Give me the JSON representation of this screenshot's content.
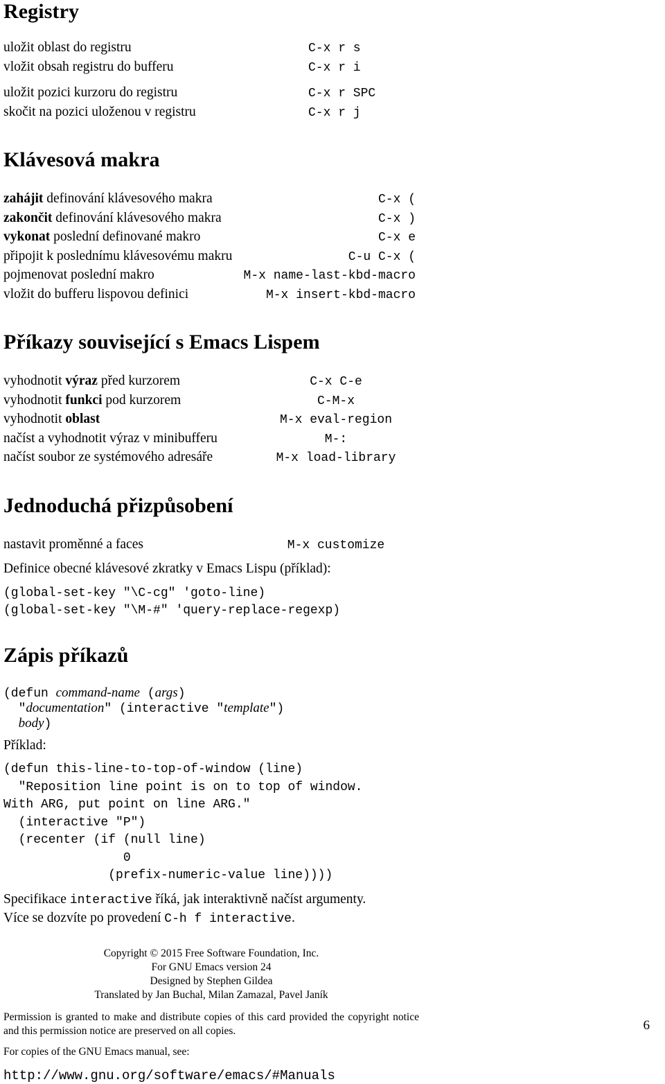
{
  "document": {
    "page_number": "6"
  },
  "sections": {
    "registry": {
      "heading": "Registry",
      "rows": [
        {
          "desc": "uložit oblast do registru",
          "key": "C-x r s"
        },
        {
          "desc": "vložit obsah registru do bufferu",
          "key": "C-x r i"
        },
        {
          "desc": "uložit pozici kurzoru do registru",
          "key": "C-x r SPC"
        },
        {
          "desc": "skočit na pozici uloženou v registru",
          "key": "C-x r j"
        }
      ]
    },
    "macros": {
      "heading": "Klávesová makra",
      "rows": [
        {
          "bold": "zahájit",
          "rest": " definování klávesového makra",
          "key": "C-x ("
        },
        {
          "bold": "zakončit",
          "rest": " definování klávesového makra",
          "key": "C-x )"
        },
        {
          "bold": "vykonat",
          "rest": " poslední definované makro",
          "key": "C-x e"
        },
        {
          "bold": "",
          "rest": "připojit k poslednímu klávesovému makru",
          "key": "C-u C-x ("
        },
        {
          "bold": "",
          "rest": "pojmenovat poslední makro",
          "key": "M-x name-last-kbd-macro"
        },
        {
          "bold": "",
          "rest": "vložit do bufferu lispovou definici",
          "key": "M-x insert-kbd-macro"
        }
      ]
    },
    "lisp": {
      "heading": "Příkazy související s Emacs Lispem",
      "rows": [
        {
          "pre": "vyhodnotit ",
          "bold": "výraz",
          "post": " před kurzorem",
          "key": "C-x C-e"
        },
        {
          "pre": "vyhodnotit ",
          "bold": "funkci",
          "post": " pod kurzorem",
          "key": "C-M-x"
        },
        {
          "pre": "vyhodnotit ",
          "bold": "oblast",
          "post": "",
          "key": "M-x eval-region"
        },
        {
          "pre": "načíst a vyhodnotit výraz v minibufferu",
          "bold": "",
          "post": "",
          "key": "M-:"
        },
        {
          "pre": "načíst soubor ze systémového adresáře",
          "bold": "",
          "post": "",
          "key": "M-x load-library"
        }
      ]
    },
    "customization": {
      "heading": "Jednoduchá přizpůsobení",
      "rows": [
        {
          "desc": "nastavit proměnné a faces",
          "key": "M-x customize"
        }
      ],
      "intro": "Definice obecné klávesové zkratky v Emacs Lispu (příklad):",
      "code_lines": [
        "(global-set-key \"\\C-cg\" 'goto-line)",
        "(global-set-key \"\\M-#\" 'query-replace-regexp)"
      ]
    },
    "writing_commands": {
      "heading": "Zápis příkazů",
      "template": {
        "line1_a": "(defun ",
        "line1_b": "command-name",
        "line1_c": " (",
        "line1_d": "args",
        "line1_e": ")",
        "line2_a": "  \"",
        "line2_b": "documentation",
        "line2_c": "\" (interactive \"",
        "line2_d": "template",
        "line2_e": "\")",
        "line3_a": "  ",
        "line3_b": "body",
        "line3_c": ")"
      },
      "example_label": "Příklad:",
      "example_code": "(defun this-line-to-top-of-window (line)\n  \"Reposition line point is on to top of window.\nWith ARG, put point on line ARG.\"\n  (interactive \"P\")\n  (recenter (if (null line)\n                0\n              (prefix-numeric-value line))))",
      "note_line1_a": "Specifikace ",
      "note_line1_b": "interactive",
      "note_line1_c": " říká, jak interaktivně načíst argumenty.",
      "note_line2_a": "Více se dozvíte po provedení ",
      "note_line2_b": "C-h f interactive",
      "note_line2_c": "."
    }
  },
  "footer": {
    "copyright": "Copyright © 2015 Free Software Foundation, Inc.",
    "version": "For GNU Emacs version 24",
    "designer": "Designed by Stephen Gildea",
    "translators": "Translated by Jan Buchal, Milan Zamazal, Pavel Janík",
    "permission": "Permission is granted to make and distribute copies of this card provided the copyright notice and this permission notice are preserved on all copies.",
    "manual_note": "For copies of the GNU Emacs manual, see:",
    "url": "http://www.gnu.org/software/emacs/#Manuals"
  }
}
